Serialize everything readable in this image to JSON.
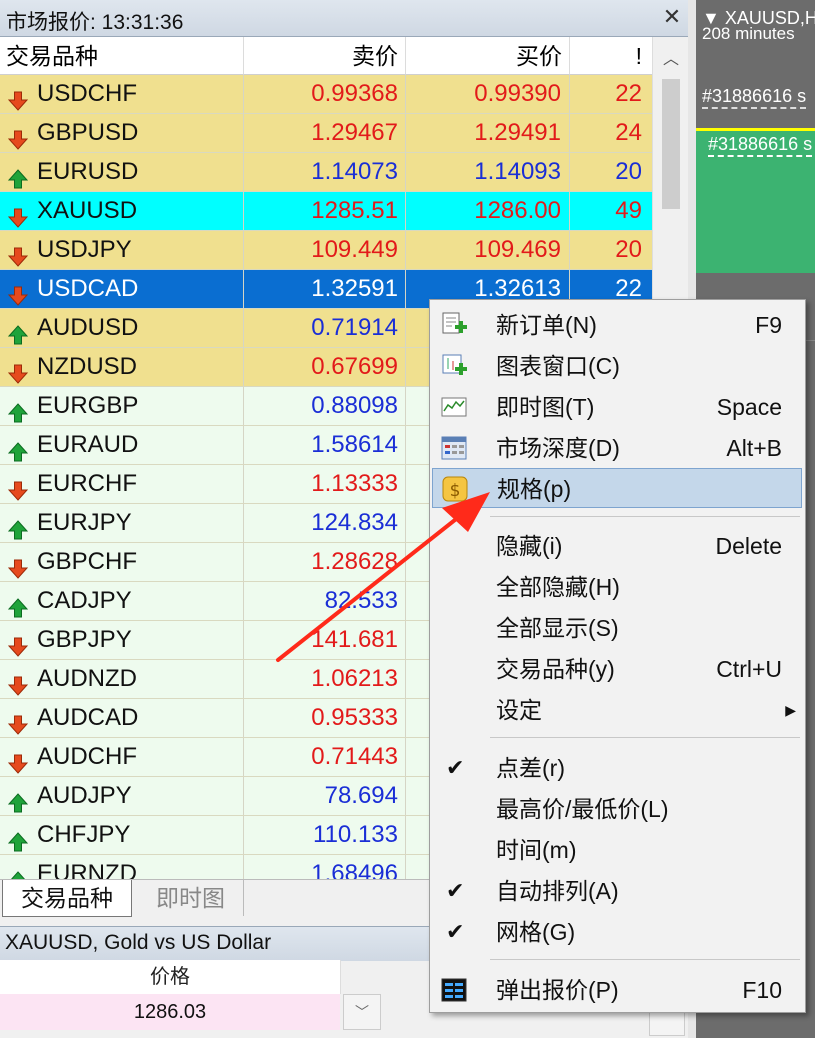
{
  "market_watch": {
    "title": "市场报价: 13:31:36",
    "close_glyph": "✕",
    "columns": {
      "symbol": "交易品种",
      "bid": "卖价",
      "ask": "买价",
      "spread": "!"
    },
    "rows": [
      {
        "symbol": "USDCHF",
        "bid": "0.99368",
        "ask": "0.99390",
        "spread": "22",
        "dir": "down",
        "bg": "#f0e08f"
      },
      {
        "symbol": "GBPUSD",
        "bid": "1.29467",
        "ask": "1.29491",
        "spread": "24",
        "dir": "down",
        "bg": "#f0e08f"
      },
      {
        "symbol": "EURUSD",
        "bid": "1.14073",
        "ask": "1.14093",
        "spread": "20",
        "dir": "up",
        "bg": "#f0e08f"
      },
      {
        "symbol": "XAUUSD",
        "bid": "1285.51",
        "ask": "1286.00",
        "spread": "49",
        "dir": "down",
        "bg": "#00ffff"
      },
      {
        "symbol": "USDJPY",
        "bid": "109.449",
        "ask": "109.469",
        "spread": "20",
        "dir": "down",
        "bg": "#f0e08f"
      },
      {
        "symbol": "USDCAD",
        "bid": "1.32591",
        "ask": "1.32613",
        "spread": "22",
        "dir": "down",
        "bg": "#0a6ed1",
        "selected": true
      },
      {
        "symbol": "AUDUSD",
        "bid": "0.71914",
        "ask": "",
        "spread": "",
        "dir": "up",
        "bg": "#f0e08f"
      },
      {
        "symbol": "NZDUSD",
        "bid": "0.67699",
        "ask": "",
        "spread": "",
        "dir": "down",
        "bg": "#f0e08f"
      },
      {
        "symbol": "EURGBP",
        "bid": "0.88098",
        "ask": "",
        "spread": "",
        "dir": "up",
        "bg": "#eefbee"
      },
      {
        "symbol": "EURAUD",
        "bid": "1.58614",
        "ask": "",
        "spread": "",
        "dir": "up",
        "bg": "#eefbee"
      },
      {
        "symbol": "EURCHF",
        "bid": "1.13333",
        "ask": "",
        "spread": "",
        "dir": "down",
        "bg": "#eefbee"
      },
      {
        "symbol": "EURJPY",
        "bid": "124.834",
        "ask": "",
        "spread": "",
        "dir": "up",
        "bg": "#eefbee"
      },
      {
        "symbol": "GBPCHF",
        "bid": "1.28628",
        "ask": "",
        "spread": "",
        "dir": "down",
        "bg": "#eefbee"
      },
      {
        "symbol": "CADJPY",
        "bid": "82.533",
        "ask": "",
        "spread": "",
        "dir": "up",
        "bg": "#eefbee"
      },
      {
        "symbol": "GBPJPY",
        "bid": "141.681",
        "ask": "",
        "spread": "",
        "dir": "down",
        "bg": "#eefbee"
      },
      {
        "symbol": "AUDNZD",
        "bid": "1.06213",
        "ask": "",
        "spread": "",
        "dir": "down",
        "bg": "#eefbee"
      },
      {
        "symbol": "AUDCAD",
        "bid": "0.95333",
        "ask": "",
        "spread": "",
        "dir": "down",
        "bg": "#eefbee"
      },
      {
        "symbol": "AUDCHF",
        "bid": "0.71443",
        "ask": "",
        "spread": "",
        "dir": "down",
        "bg": "#eefbee"
      },
      {
        "symbol": "AUDJPY",
        "bid": "78.694",
        "ask": "",
        "spread": "",
        "dir": "up",
        "bg": "#eefbee"
      },
      {
        "symbol": "CHFJPY",
        "bid": "110.133",
        "ask": "",
        "spread": "",
        "dir": "up",
        "bg": "#eefbee"
      },
      {
        "symbol": "EURNZD",
        "bid": "1.68496",
        "ask": "",
        "spread": "",
        "dir": "up",
        "bg": "#eefbee"
      }
    ],
    "tabs": {
      "symbols": "交易品种",
      "tick": "即时图"
    }
  },
  "detail": {
    "title": "XAUUSD, Gold vs US Dollar",
    "price_header": "价格",
    "price_value": "1286.03"
  },
  "chart": {
    "title": "XAUUSD,H",
    "subtitle": "208 minutes",
    "order_label_1": "#31886616 s",
    "order_label_2": "#31886616 s",
    "colors": {
      "background": "#6c6c6c",
      "profit_zone": "#3cb371",
      "price_line": "#ffff00"
    }
  },
  "context_menu": {
    "items": [
      {
        "label": "新订单(N)",
        "shortcut": "F9",
        "icon": "new-order-icon"
      },
      {
        "label": "图表窗口(C)",
        "shortcut": "",
        "icon": "chart-window-icon"
      },
      {
        "label": "即时图(T)",
        "shortcut": "Space",
        "icon": "tick-chart-icon"
      },
      {
        "label": "市场深度(D)",
        "shortcut": "Alt+B",
        "icon": "market-depth-icon"
      },
      {
        "label": "规格(p)",
        "shortcut": "",
        "icon": "specification-icon",
        "highlighted": true
      },
      {
        "label": "隐藏(i)",
        "shortcut": "Delete"
      },
      {
        "label": "全部隐藏(H)",
        "shortcut": ""
      },
      {
        "label": "全部显示(S)",
        "shortcut": ""
      },
      {
        "label": "交易品种(y)",
        "shortcut": "Ctrl+U"
      },
      {
        "label": "设定",
        "shortcut": "",
        "submenu": true
      },
      {
        "label": "点差(r)",
        "shortcut": "",
        "checked": true
      },
      {
        "label": "最高价/最低价(L)",
        "shortcut": ""
      },
      {
        "label": "时间(m)",
        "shortcut": ""
      },
      {
        "label": "自动排列(A)",
        "shortcut": "",
        "checked": true
      },
      {
        "label": "网格(G)",
        "shortcut": "",
        "checked": true
      },
      {
        "label": "弹出报价(P)",
        "shortcut": "F10",
        "icon": "popup-prices-icon"
      }
    ]
  }
}
